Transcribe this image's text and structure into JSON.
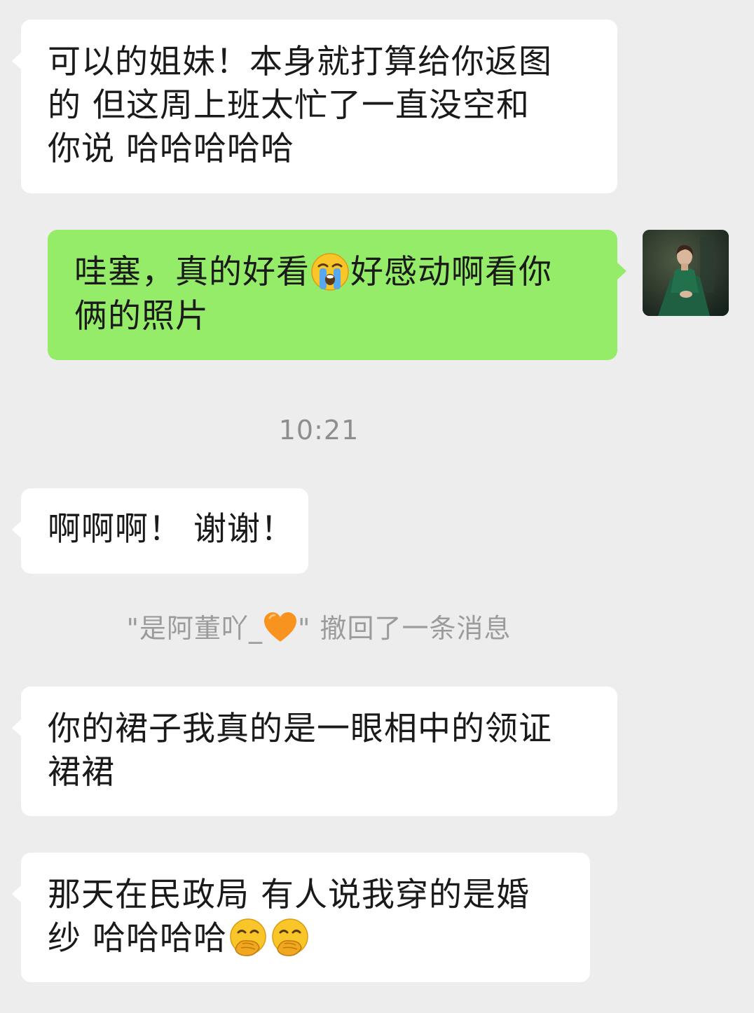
{
  "chat": {
    "messages": [
      {
        "id": "msg-1",
        "side": "left",
        "lines": [
          "可以的姐妹！本身就打算给你返图",
          "的 但这周上班太忙了一直没空和",
          "你说 哈哈哈哈哈"
        ]
      },
      {
        "id": "msg-2",
        "side": "right",
        "line1_a": "哇塞，真的好看",
        "line1_emoji": "loudly-crying-face",
        "line1_b": "好感动啊看你",
        "line2": "俩的照片"
      },
      {
        "id": "msg-3",
        "side": "left",
        "lines": [
          "啊啊啊！ 谢谢！"
        ]
      },
      {
        "id": "msg-4",
        "side": "left",
        "lines": [
          "你的裙子我真的是一眼相中的领证",
          "裙裙"
        ]
      },
      {
        "id": "msg-5",
        "side": "left",
        "line1": "那天在民政局 有人说我穿的是婚",
        "line2_text": "纱 哈哈哈哈",
        "line2_emojis": [
          "face-with-hand-over-mouth",
          "face-with-hand-over-mouth"
        ]
      }
    ],
    "timestamp": "10:21",
    "recall_notice": {
      "prefix": "\"是阿董吖_",
      "heart_emoji": "orange-heart",
      "suffix": "\" 撤回了一条消息"
    }
  },
  "colors": {
    "background": "#ededed",
    "incoming_bubble": "#ffffff",
    "outgoing_bubble": "#95ec69",
    "text": "#1a1a1a",
    "meta_text": "#8e8e8e"
  }
}
